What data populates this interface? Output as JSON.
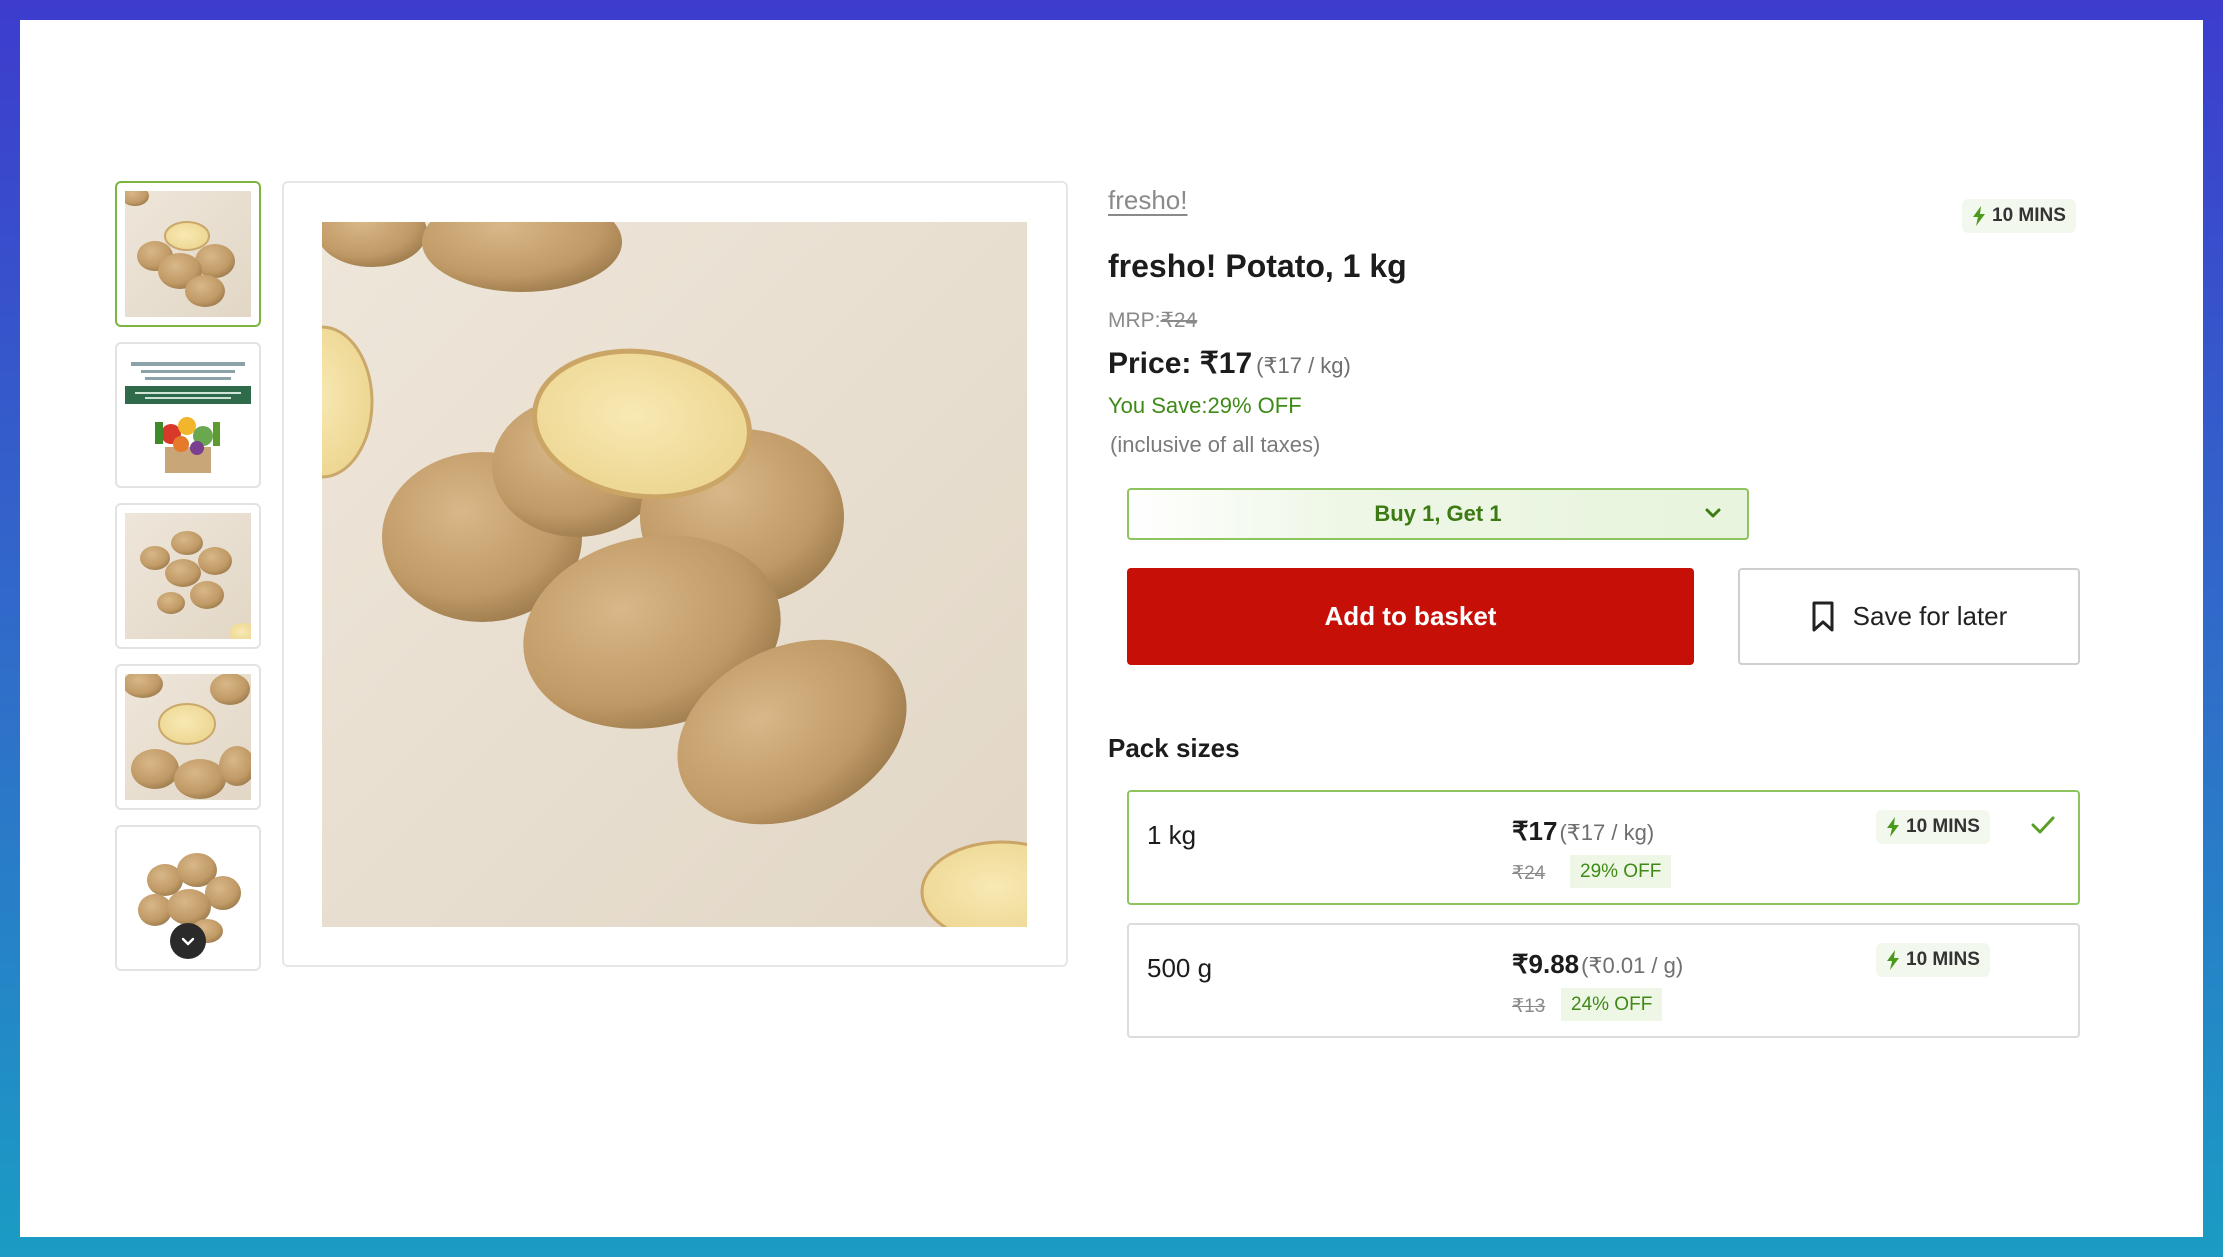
{
  "product": {
    "brand": "fresho!",
    "title": "fresho! Potato, 1 kg",
    "mrp_label": "MRP:",
    "mrp_value": "₹24",
    "price_label": "Price: ₹17",
    "price_unit": "(₹17 / kg)",
    "save_label": "You Save:",
    "save_value": "29% OFF",
    "tax_note": "(inclusive of all taxes)",
    "eta": "10 MINS"
  },
  "offer": {
    "label": "Buy 1, Get 1"
  },
  "actions": {
    "add_label": "Add to basket",
    "later_label": "Save for later"
  },
  "gallery": {
    "thumbnail_count": 5,
    "selected_index": 0,
    "icon": "chevron-down-icon"
  },
  "pack_sizes": {
    "title": "Pack sizes",
    "items": [
      {
        "size": "1 kg",
        "price": "₹17",
        "unit": "(₹17 / kg)",
        "mrp": "₹24",
        "off": "29% OFF",
        "eta": "10 MINS",
        "selected": true
      },
      {
        "size": "500 g",
        "price": "₹9.88",
        "unit": "(₹0.01 / g)",
        "mrp": "₹13",
        "off": "24% OFF",
        "eta": "10 MINS",
        "selected": false
      }
    ]
  },
  "colors": {
    "accent_red": "#c60f06",
    "accent_green": "#3f8a17",
    "selected_border": "#8ec45e",
    "background_gradient_top": "#3d3ccd",
    "background_gradient_bottom": "#1a9cc4"
  }
}
